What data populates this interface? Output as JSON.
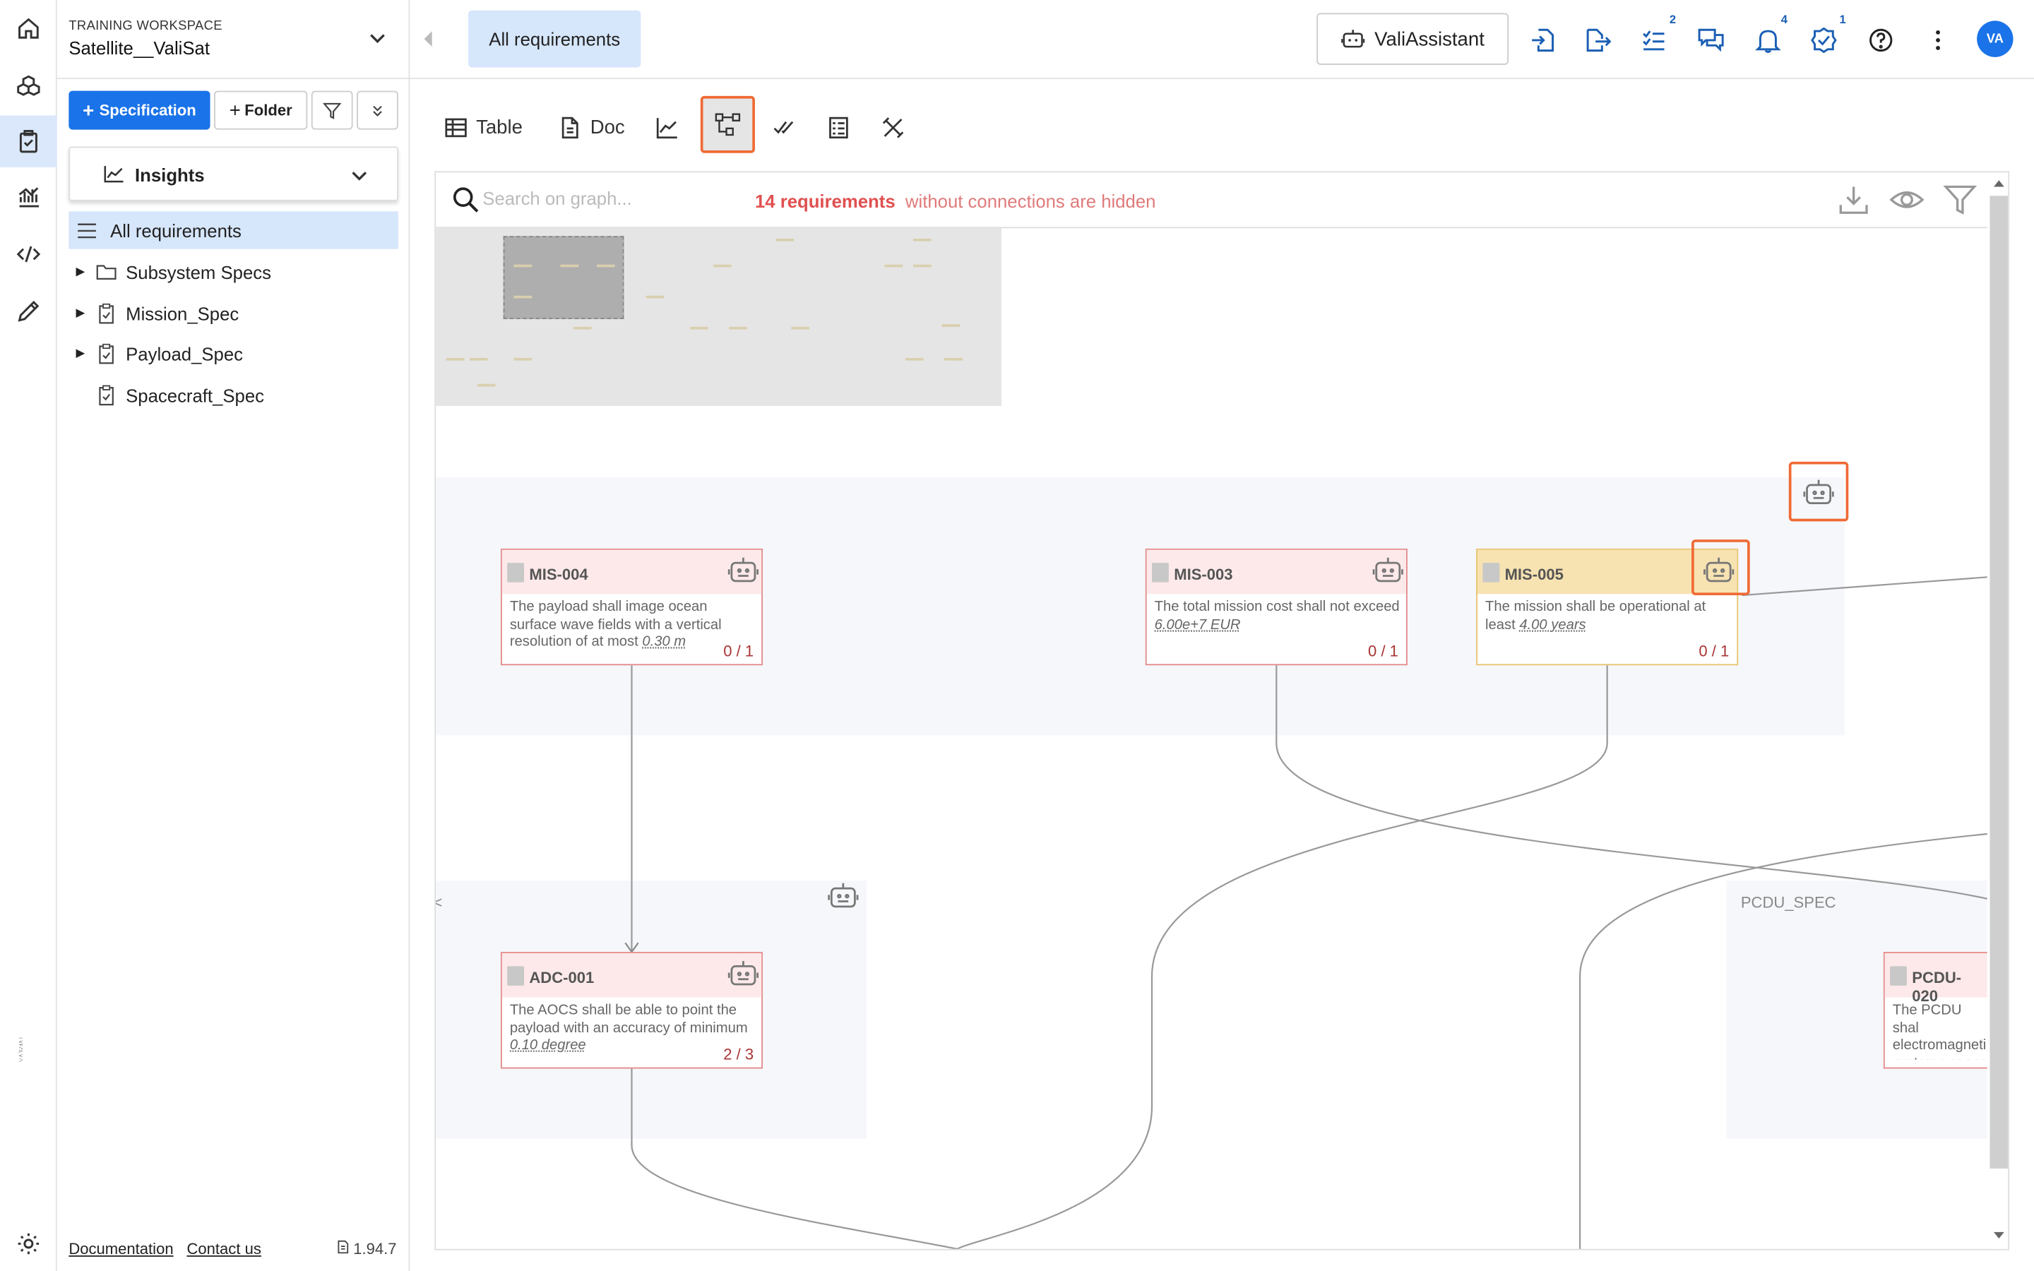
{
  "workspace": {
    "label": "TRAINING WORKSPACE",
    "name": "Satellite__ValiSat"
  },
  "sidebar": {
    "spec_button": "Specification",
    "folder_button": "Folder",
    "insights_label": "Insights",
    "items": [
      {
        "label": "All requirements"
      },
      {
        "label": "Subsystem Specs"
      },
      {
        "label": "Mission_Spec"
      },
      {
        "label": "Payload_Spec"
      },
      {
        "label": "Spacecraft_Spec"
      }
    ],
    "footer": {
      "documentation": "Documentation",
      "contact": "Contact us",
      "version": "1.94.7"
    }
  },
  "header": {
    "tab_label": "All requirements",
    "assistant_label": "ValiAssistant",
    "badges": {
      "tasks": "2",
      "notifications": "4",
      "reviews": "1"
    },
    "avatar": "VA"
  },
  "toolbar": {
    "table_label": "Table",
    "doc_label": "Doc"
  },
  "graph": {
    "search_placeholder": "Search on graph...",
    "hidden_count": "14 requirements",
    "hidden_text": "without connections are hidden",
    "group_label": "PCDU_SPEC",
    "nodes": [
      {
        "id": "MIS-004",
        "text": "The payload shall image ocean surface wave fields with a vertical resolution of at most ",
        "value": "0.30  m",
        "count": "0 / 1"
      },
      {
        "id": "MIS-003",
        "text": "The total mission cost shall not exceed ",
        "value": "6.00e+7  EUR",
        "count": "0 / 1"
      },
      {
        "id": "MIS-005",
        "text": "The mission shall be operational at least ",
        "value": "4.00  years",
        "count": "0 / 1"
      },
      {
        "id": "ADC-001",
        "text": "The AOCS shall be able to point the payload with an accuracy of minimum ",
        "value": "0.10  degree",
        "count": "2 / 3"
      },
      {
        "id": "PCDU-020",
        "text": "The PCDU shal electromagneti systems or ser",
        "value": "",
        "count": ""
      }
    ]
  },
  "colors": {
    "accent": "#1a73e8",
    "highlight": "#f06a35",
    "node_red": "#fde9ea",
    "node_orange": "#f7e2b2"
  }
}
